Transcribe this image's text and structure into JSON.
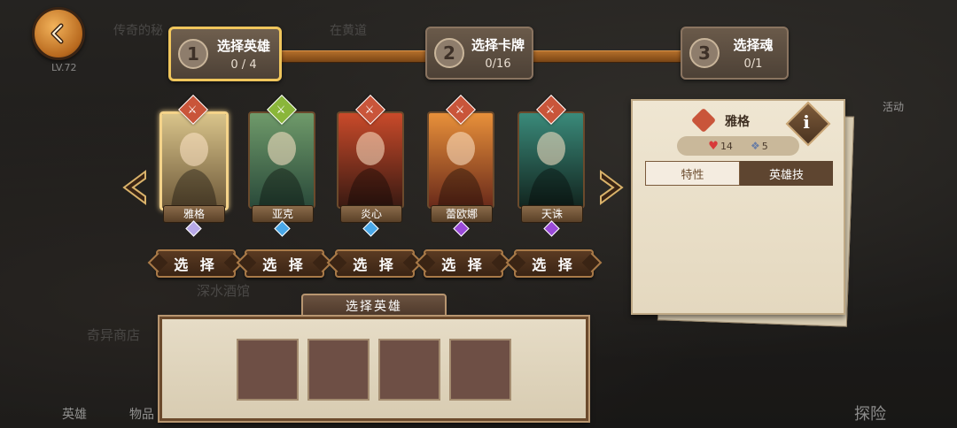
{
  "background": {
    "texts": [
      "传奇的秘",
      "在黄道",
      "深水酒馆",
      "奇异商店",
      "英雄",
      "物品",
      "探险",
      "活动"
    ]
  },
  "player": {
    "level": "LV.72"
  },
  "steps": [
    {
      "num": "1",
      "title": "选择英雄",
      "count": "0 / 4",
      "active": true
    },
    {
      "num": "2",
      "title": "选择卡牌",
      "count": "0/16",
      "active": false
    },
    {
      "num": "3",
      "title": "选择魂",
      "count": "0/1",
      "active": false
    }
  ],
  "heroes": [
    {
      "name": "雅格",
      "select_label": "选 择",
      "selected": true,
      "badge_color": "#c9553a",
      "gem_color": "#b8a9e8",
      "art": [
        "#d9c48a",
        "#6e5a3a"
      ]
    },
    {
      "name": "亚克",
      "select_label": "选 择",
      "selected": false,
      "badge_color": "#8ab63a",
      "gem_color": "#4aa8e8",
      "art": [
        "#6f9a6a",
        "#2a4a3a"
      ]
    },
    {
      "name": "炎心",
      "select_label": "选 择",
      "selected": false,
      "badge_color": "#c9553a",
      "gem_color": "#4aa8e8",
      "art": [
        "#c94a2a",
        "#3a1a12"
      ]
    },
    {
      "name": "蕾欧娜",
      "select_label": "选 择",
      "selected": false,
      "badge_color": "#c9553a",
      "gem_color": "#9a4ad8",
      "art": [
        "#e8903a",
        "#6a2a1a"
      ]
    },
    {
      "name": "天诛",
      "select_label": "选 择",
      "selected": false,
      "badge_color": "#c9553a",
      "gem_color": "#9a4ad8",
      "art": [
        "#3a8a7a",
        "#12251f"
      ]
    }
  ],
  "info_panel": {
    "hero_name": "雅格",
    "info_glyph": "i",
    "hp": "14",
    "cards": "5",
    "tabs": [
      "特性",
      "英雄技"
    ]
  },
  "slots_panel": {
    "title": "选择英雄",
    "slot_count": 4
  }
}
